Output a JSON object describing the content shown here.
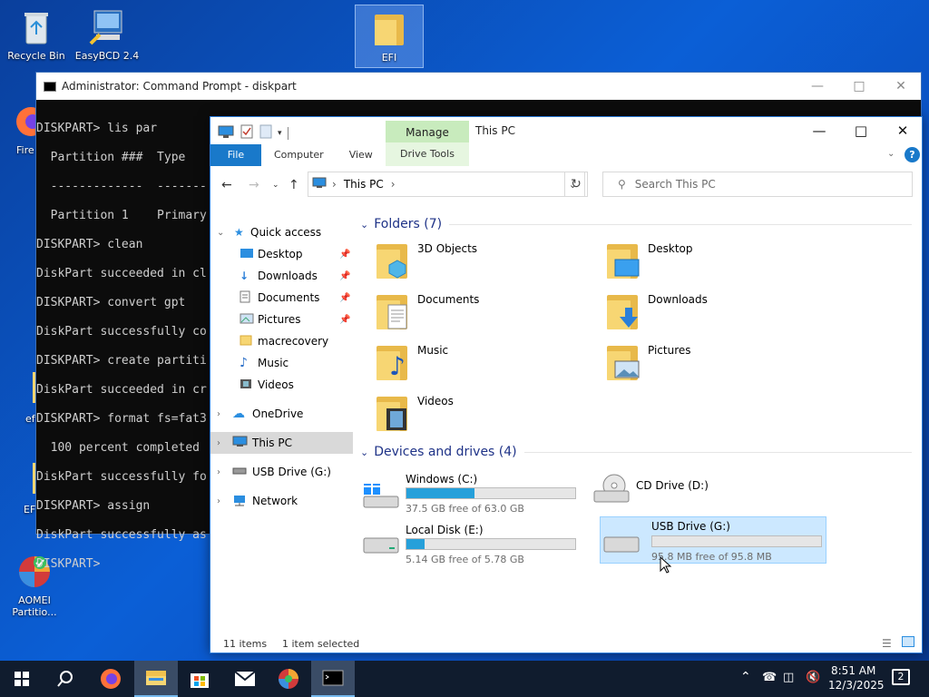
{
  "desktop": {
    "icons": [
      {
        "label": "Recycle Bin"
      },
      {
        "label": "EasyBCD 2.4"
      },
      {
        "label": "EFI"
      },
      {
        "label": "Fire"
      },
      {
        "label": "ef"
      },
      {
        "label": "EF"
      },
      {
        "label": "AOMEI Partitio..."
      }
    ]
  },
  "cmd": {
    "title": "Administrator: Command Prompt - diskpart",
    "lines": [
      "DISKPART> lis par",
      "",
      "  Partition ###  Type      ",
      "  -------------  -------   ",
      "  Partition 1    Primary   ",
      "",
      "DISKPART> clean",
      "",
      "DiskPart succeeded in cl",
      "",
      "DISKPART> convert gpt",
      "",
      "DiskPart successfully co",
      "",
      "DISKPART> create partiti",
      "",
      "DiskPart succeeded in cr",
      "",
      "DISKPART> format fs=fat3",
      "",
      "  100 percent completed",
      "",
      "DiskPart successfully fo",
      "",
      "DISKPART> assign",
      "",
      "DiskPart successfully as",
      "",
      "DISKPART> "
    ]
  },
  "explorer": {
    "title": "This PC",
    "manage_label": "Manage",
    "ribbon_tabs": [
      "File",
      "Computer",
      "View",
      "Drive Tools"
    ],
    "address": "This PC",
    "search_placeholder": "Search This PC",
    "nav": [
      {
        "label": "Quick access"
      },
      {
        "label": "Desktop"
      },
      {
        "label": "Downloads"
      },
      {
        "label": "Documents"
      },
      {
        "label": "Pictures"
      },
      {
        "label": "macrecovery"
      },
      {
        "label": "Music"
      },
      {
        "label": "Videos"
      },
      {
        "label": "OneDrive"
      },
      {
        "label": "This PC"
      },
      {
        "label": "USB Drive (G:)"
      },
      {
        "label": "Network"
      }
    ],
    "folders_header": "Folders (7)",
    "folders": [
      "3D Objects",
      "Desktop",
      "Documents",
      "Downloads",
      "Music",
      "Pictures",
      "Videos"
    ],
    "devices_header": "Devices and drives (4)",
    "drives": [
      {
        "name": "Windows (C:)",
        "free": "37.5 GB free of 63.0 GB",
        "used_fraction": 0.405
      },
      {
        "name": "CD Drive (D:)",
        "free": "",
        "used_fraction": null
      },
      {
        "name": "Local Disk (E:)",
        "free": "5.14 GB free of 5.78 GB",
        "used_fraction": 0.11
      },
      {
        "name": "USB Drive (G:)",
        "free": "95.8 MB free of 95.8 MB",
        "used_fraction": 0.0
      }
    ],
    "status_items": "11 items",
    "status_selected": "1 item selected"
  },
  "taskbar": {
    "time": "8:51 AM",
    "date": "12/3/2025",
    "notif_count": "2"
  },
  "colors": {
    "accent": "#1979ca",
    "drive_bar": "#26a0da",
    "manage_tab": "#c8ebbd"
  }
}
